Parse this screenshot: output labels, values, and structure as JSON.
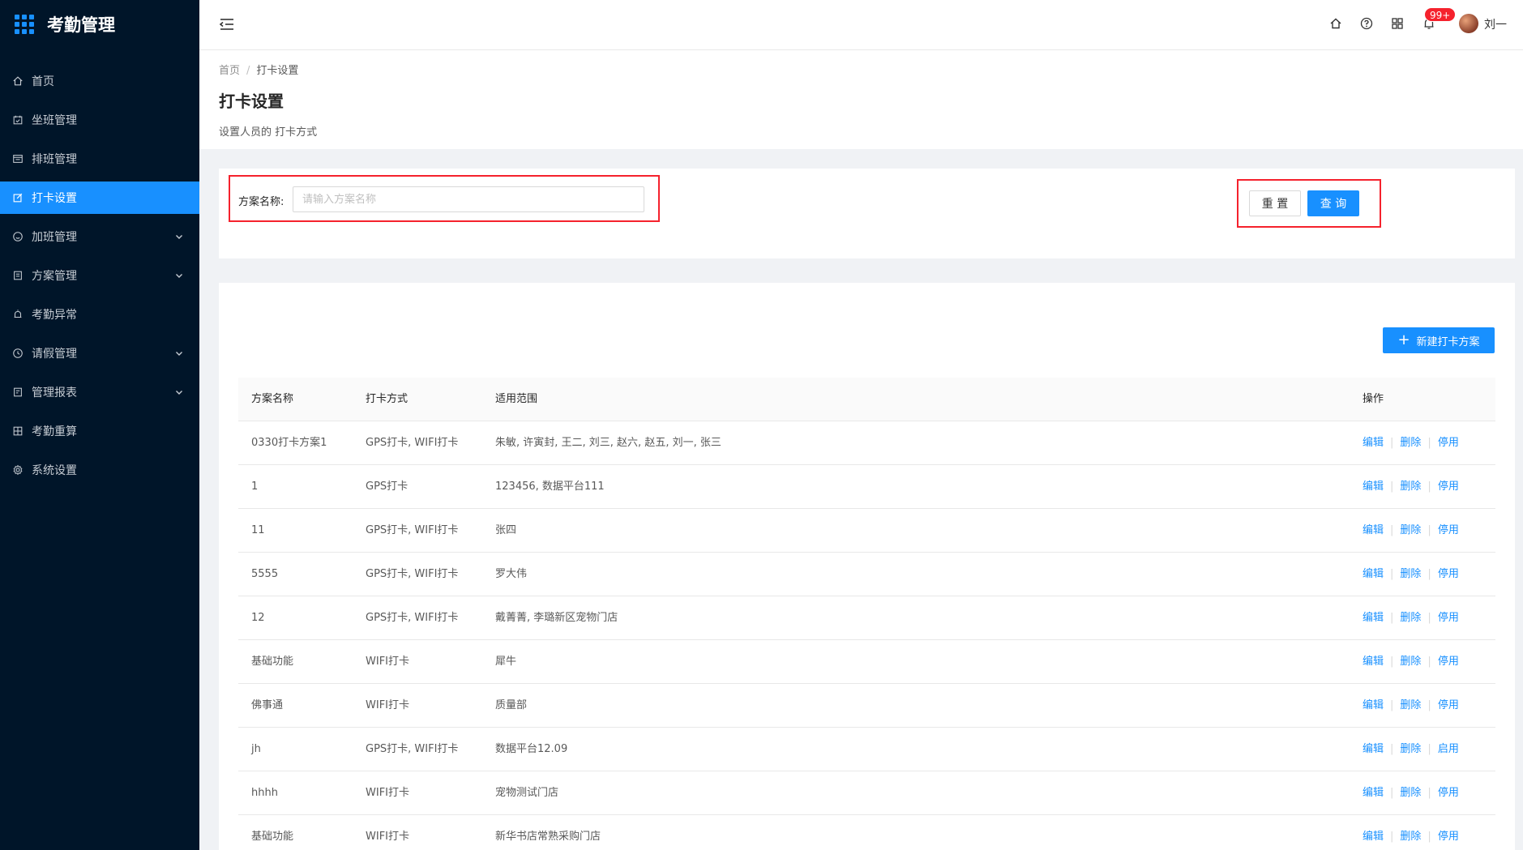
{
  "app": {
    "title": "考勤管理"
  },
  "sidebar": {
    "items": [
      {
        "label": "首页",
        "icon": "home-icon",
        "has_arrow": false,
        "active": false
      },
      {
        "label": "坐班管理",
        "icon": "calendar-check-icon",
        "has_arrow": false,
        "active": false
      },
      {
        "label": "排班管理",
        "icon": "schedule-icon",
        "has_arrow": false,
        "active": false
      },
      {
        "label": "打卡设置",
        "icon": "edit-icon",
        "has_arrow": false,
        "active": true
      },
      {
        "label": "加班管理",
        "icon": "smile-icon",
        "has_arrow": true,
        "active": false
      },
      {
        "label": "方案管理",
        "icon": "document-icon",
        "has_arrow": true,
        "active": false
      },
      {
        "label": "考勤异常",
        "icon": "alarm-icon",
        "has_arrow": false,
        "active": false
      },
      {
        "label": "请假管理",
        "icon": "clock-icon",
        "has_arrow": true,
        "active": false
      },
      {
        "label": "管理报表",
        "icon": "report-icon",
        "has_arrow": true,
        "active": false
      },
      {
        "label": "考勤重算",
        "icon": "calculator-icon",
        "has_arrow": false,
        "active": false
      },
      {
        "label": "系统设置",
        "icon": "gear-icon",
        "has_arrow": false,
        "active": false
      }
    ]
  },
  "header": {
    "notification_badge": "99+",
    "username": "刘一"
  },
  "page": {
    "breadcrumb": {
      "home": "首页",
      "current": "打卡设置"
    },
    "title": "打卡设置",
    "description": "设置人员的 打卡方式"
  },
  "search": {
    "label": "方案名称:",
    "placeholder": "请输入方案名称",
    "value": "",
    "reset_label": "重 置",
    "query_label": "查 询"
  },
  "table": {
    "new_button_label": "新建打卡方案",
    "columns": [
      "方案名称",
      "打卡方式",
      "适用范围",
      "操作"
    ],
    "rows": [
      {
        "name": "0330打卡方案1",
        "method": "GPS打卡, WIFI打卡",
        "scope": "朱敏, 许寅封, 王二, 刘三, 赵六, 赵五, 刘一, 张三",
        "toggle": "停用"
      },
      {
        "name": "1",
        "method": "GPS打卡",
        "scope": "123456, 数据平台111",
        "toggle": "停用"
      },
      {
        "name": "11",
        "method": "GPS打卡, WIFI打卡",
        "scope": "张四",
        "toggle": "停用"
      },
      {
        "name": "5555",
        "method": "GPS打卡, WIFI打卡",
        "scope": "罗大伟",
        "toggle": "停用"
      },
      {
        "name": "12",
        "method": "GPS打卡, WIFI打卡",
        "scope": "戴菁菁, 李璐新区宠物门店",
        "toggle": "停用"
      },
      {
        "name": "基础功能",
        "method": "WIFI打卡",
        "scope": "犀牛",
        "toggle": "停用"
      },
      {
        "name": "佛事通",
        "method": "WIFI打卡",
        "scope": "质量部",
        "toggle": "停用"
      },
      {
        "name": "jh",
        "method": "GPS打卡, WIFI打卡",
        "scope": "数据平台12.09",
        "toggle": "启用"
      },
      {
        "name": "hhhh",
        "method": "WIFI打卡",
        "scope": "宠物测试门店",
        "toggle": "停用"
      },
      {
        "name": "基础功能",
        "method": "WIFI打卡",
        "scope": "新华书店常熟采购门店",
        "toggle": "停用"
      }
    ],
    "edit_label": "编辑",
    "delete_label": "删除"
  },
  "colors": {
    "sidebar_bg": "#001529",
    "primary": "#1890ff",
    "highlight_box": "#f5222d",
    "badge": "#f5222d"
  }
}
